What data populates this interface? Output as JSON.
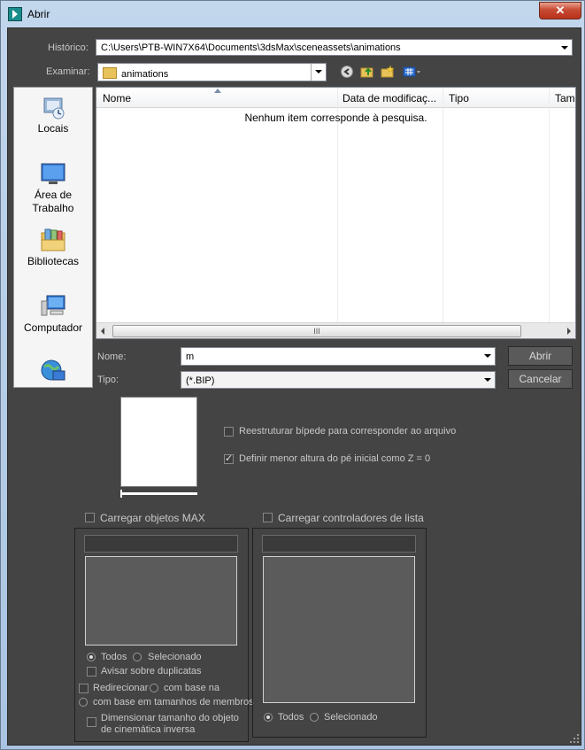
{
  "window": {
    "title": "Abrir",
    "close_label": "✕"
  },
  "historico": {
    "label": "Histórico:",
    "value": "C:\\Users\\PTB-WIN7X64\\Documents\\3dsMax\\sceneassets\\animations"
  },
  "examinar": {
    "label": "Examinar:",
    "value": "animations"
  },
  "places": [
    {
      "label": "Locais"
    },
    {
      "label": "Área de\nTrabalho"
    },
    {
      "label": "Bibliotecas"
    },
    {
      "label": "Computador"
    },
    {
      "label": ""
    }
  ],
  "file_list": {
    "columns": [
      "Nome",
      "Data de modificaç...",
      "Tipo",
      "Tam"
    ],
    "empty_message": "Nenhum item corresponde à pesquisa.",
    "scroll_thumb": "III"
  },
  "nome": {
    "label": "Nome:",
    "value": "m"
  },
  "tipo": {
    "label": "Tipo:",
    "value": "(*.BIP)"
  },
  "buttons": {
    "open": "Abrir",
    "cancel": "Cancelar"
  },
  "options": {
    "restructure": {
      "label": "Reestruturar bípede para corresponder ao arquivo",
      "checked": false
    },
    "min_height": {
      "label": "Definir menor altura do pé inicial como Z = 0",
      "checked": true
    }
  },
  "max_objects": {
    "label": "Carregar objetos MAX",
    "checked": false,
    "radio_all": "Todos",
    "radio_selected": "Selecionado",
    "warn_duplicates": "Avisar sobre duplicatas",
    "redirect": "Redirecionar",
    "by_name": "com base na",
    "by_limb_size": "com base em tamanhos de membros",
    "resize_ik_line1": "Dimensionar tamanho do objeto",
    "resize_ik_line2": "de cinemática inversa"
  },
  "list_controllers": {
    "label": "Carregar controladores de lista",
    "checked": false,
    "radio_all": "Todos",
    "radio_selected": "Selecionado"
  }
}
